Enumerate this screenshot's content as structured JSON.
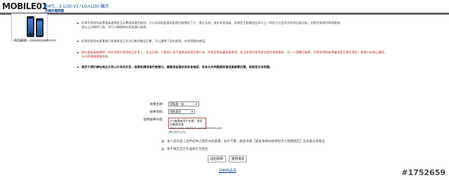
{
  "header": {
    "logo_text": "MOBILE01",
    "title": "第4代... 3-1230 V3 / LGA1150 顯示",
    "subtitle": "回報所需問題"
  },
  "product": {
    "caption": "商品編號：213082108915241"
  },
  "notices": [
    {
      "lines": [
        "如果您發現有買賣會員違規並且反覆違規遭到刪除，可以先採取監督與監察回報網站下方「違反社群」確認本管理員，如果您主動確認並與非上一節的方式並利用其他回報功能，如果您發現特殊問題者，",
        "請以上回報的行銷，您可以聯絡網站系統進行檢舉。"
      ]
    },
    {
      "lines": [
        "如果您發現有買賣或行銷違規並且多次回報請確認回覆，可以選擇下面的處理，有效問題的確認。"
      ]
    },
    {
      "lines": [
        "當社會會員檢舉時，將在系統中處理商品訊息上，並且記錄，只要有行為不當者或者是詐欺行為，將會管理員審核後處理，並且接收到使用者並提供相關服務，同一人連續五檢舉，如果發現經檢舉審核是否違反規定，會處分或停止權限，",
        "另外將違規通報系統。"
      ]
    },
    {
      "lines": [
        "買家不得於網站商品交易以外其他交易，檢舉後請填寫完整欄位，讓管理者審核後將會確認，若有任何問題請與管理員聯繫回覆，確認是否有問題。"
      ]
    }
  ],
  "form": {
    "report_subject_label": "檢舉主題：",
    "report_subject_value": "請點選一項",
    "report_item_label": "檢舉項目：",
    "report_item_value": "請點選項",
    "content_label": "說明檢舉內容：",
    "content_value": "(%)檢舉者用戶名稱：請寫出檢舉對象https://www.mobile01.com/topicdetail.php?f=",
    "char_limit": "(500個字元內)",
    "option1": "本人茲同意上述所提供之資料內容屬實，如有不實，願意承擔【違反本網站檢舉程序之相關規定】或承擔法律責任",
    "option2": "我不確定是否有違規行為發生",
    "submit_button": "送出檢舉",
    "reset_button": "重新填寫"
  },
  "footer": {
    "back_link": "回到商品頁",
    "watermark": "#1752659"
  }
}
